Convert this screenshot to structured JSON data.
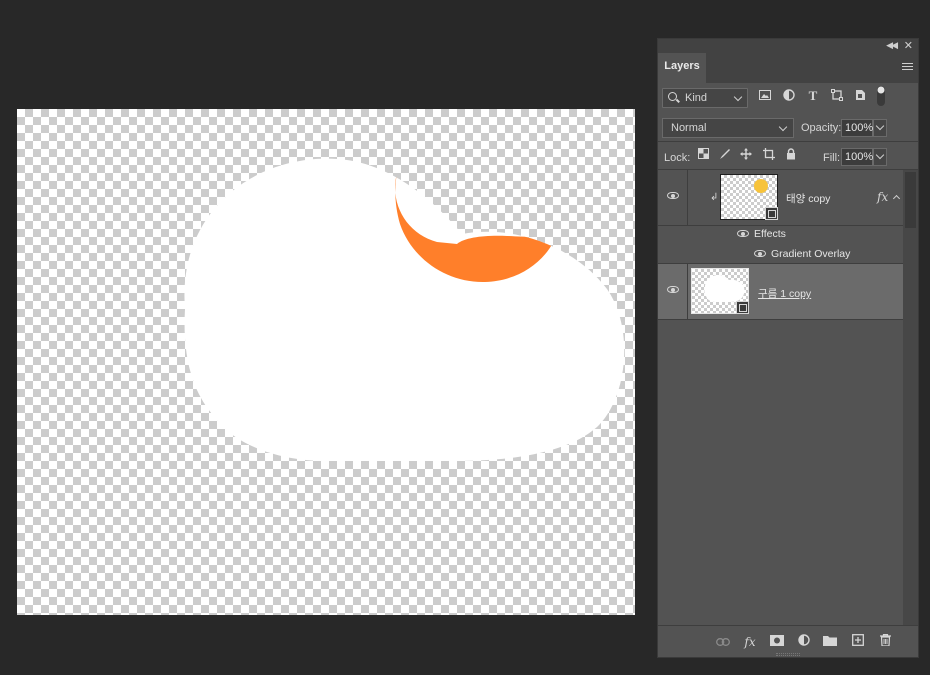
{
  "canvas": {
    "colors": {
      "cloud": "#ffffff",
      "sun_gradient": "#ff7f2a",
      "sun_thumb": "#f7c33b"
    }
  },
  "panel": {
    "tab_label": "Layers",
    "filter": {
      "kind_label": "Kind",
      "icons": [
        "image-filter-icon",
        "adjustment-filter-icon",
        "type-filter-icon",
        "shape-filter-icon",
        "smart-object-filter-icon",
        "filter-toggle"
      ]
    },
    "blend": {
      "mode": "Normal",
      "opacity_label": "Opacity:",
      "opacity_value": "100%"
    },
    "lock": {
      "label": "Lock:",
      "fill_label": "Fill:",
      "fill_value": "100%"
    },
    "layers": [
      {
        "name": "태양 copy",
        "selected": false,
        "has_fx": true,
        "clipped": true,
        "effects_label": "Effects",
        "effects": [
          "Gradient Overlay"
        ]
      },
      {
        "name": "구름 1 copy",
        "selected": true,
        "has_fx": false,
        "clipped": false
      }
    ],
    "bottom_icons": [
      "link-icon",
      "fx-icon",
      "mask-icon",
      "adjustment-icon",
      "folder-icon",
      "new-layer-icon",
      "trash-icon"
    ]
  }
}
